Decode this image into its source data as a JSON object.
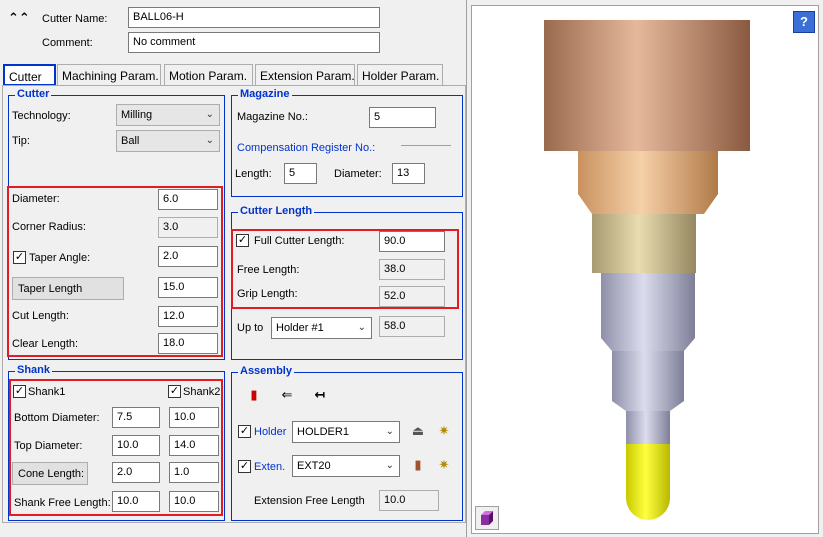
{
  "header": {
    "cutter_name_label": "Cutter Name:",
    "cutter_name_value": "BALL06-H",
    "comment_label": "Comment:",
    "comment_value": "No comment"
  },
  "tabs": [
    {
      "label": "Cutter",
      "active": true
    },
    {
      "label": "Machining Param."
    },
    {
      "label": "Motion Param."
    },
    {
      "label": "Extension Param."
    },
    {
      "label": "Holder Param."
    }
  ],
  "cutter": {
    "title": "Cutter",
    "technology_label": "Technology:",
    "technology_value": "Milling",
    "tip_label": "Tip:",
    "tip_value": "Ball",
    "diameter_label": "Diameter:",
    "diameter_value": "6.0",
    "corner_radius_label": "Corner Radius:",
    "corner_radius_value": "3.0",
    "taper_angle_label": "Taper Angle:",
    "taper_angle_value": "2.0",
    "taper_length_label": "Taper Length",
    "taper_length_value": "15.0",
    "cut_length_label": "Cut Length:",
    "cut_length_value": "12.0",
    "clear_length_label": "Clear Length:",
    "clear_length_value": "18.0"
  },
  "shank": {
    "title": "Shank",
    "shank1_label": "Shank1",
    "shank2_label": "Shank2",
    "bottom_diameter_label": "Bottom Diameter:",
    "bottom_diameter_1": "7.5",
    "bottom_diameter_2": "10.0",
    "top_diameter_label": "Top Diameter:",
    "top_diameter_1": "10.0",
    "top_diameter_2": "14.0",
    "cone_length_label": "Cone Length:",
    "cone_length_1": "2.0",
    "cone_length_2": "1.0",
    "free_length_label": "Shank Free Length:",
    "free_length_1": "10.0",
    "free_length_2": "10.0"
  },
  "magazine": {
    "title": "Magazine",
    "magazine_no_label": "Magazine No.:",
    "magazine_no_value": "5",
    "comp_register_label": "Compensation Register No.:",
    "length_label": "Length:",
    "length_value": "5",
    "diameter_label": "Diameter:",
    "diameter_value": "13"
  },
  "cutter_length": {
    "title": "Cutter Length",
    "full_label": "Full Cutter Length:",
    "full_value": "90.0",
    "free_label": "Free Length:",
    "free_value": "38.0",
    "grip_label": "Grip Length:",
    "grip_value": "52.0",
    "upto_label": "Up to",
    "upto_value": "Holder #1",
    "upto_length": "58.0"
  },
  "assembly": {
    "title": "Assembly",
    "holder_label": "Holder",
    "holder_value": "HOLDER1",
    "exten_label": "Exten.",
    "exten_value": "EXT20",
    "ext_free_label": "Extension Free Length",
    "ext_free_value": "10.0"
  },
  "preview": {
    "help_label": "?"
  }
}
